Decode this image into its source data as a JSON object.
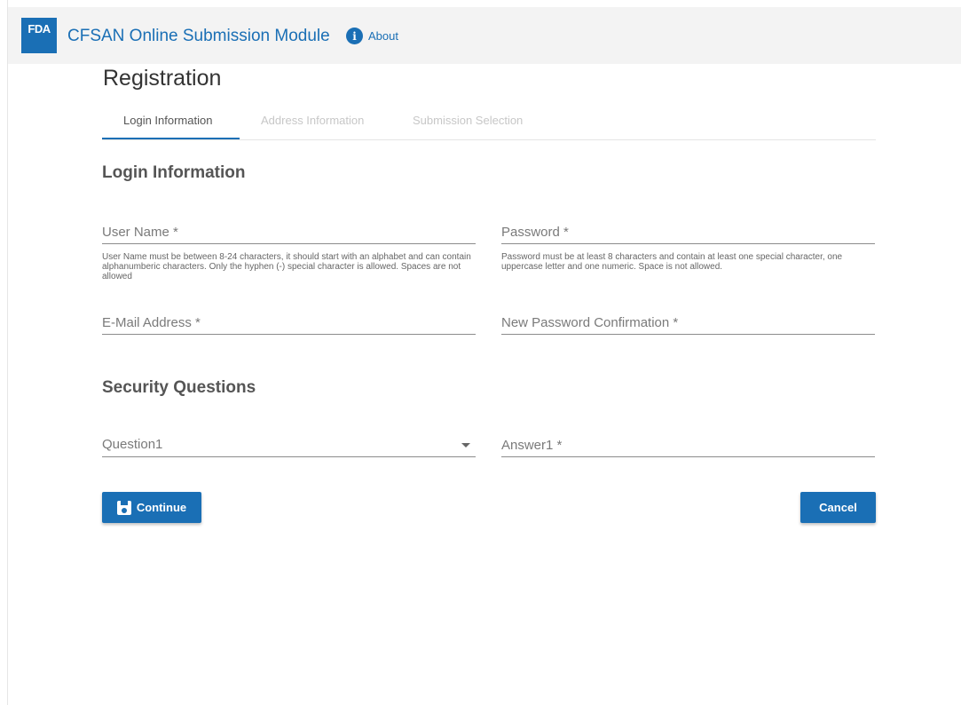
{
  "header": {
    "logo_text": "FDA",
    "title": "CFSAN Online Submission Module",
    "info_icon": "info-icon",
    "info_glyph": "i",
    "about_label": "About"
  },
  "page": {
    "title": "Registration"
  },
  "tabs": [
    {
      "label": "Login Information",
      "active": true
    },
    {
      "label": "Address Information",
      "active": false
    },
    {
      "label": "Submission Selection",
      "active": false
    }
  ],
  "login_section": {
    "title": "Login Information",
    "username": {
      "placeholder": "User Name *",
      "value": "",
      "hint": "User Name must be between 8-24 characters, it should start with an alphabet and can contain alphanumberic characters. Only the hyphen (-) special character is allowed. Spaces are not allowed"
    },
    "password": {
      "placeholder": "Password *",
      "value": "",
      "hint": "Password must be at least 8 characters and contain at least one special character, one uppercase letter and one numeric. Space is not allowed."
    },
    "email": {
      "placeholder": "E-Mail Address *",
      "value": ""
    },
    "password_confirm": {
      "placeholder": "New Password Confirmation *",
      "value": ""
    }
  },
  "security_section": {
    "title": "Security Questions",
    "question": {
      "selected": "Question1",
      "icon": "chevron-down-icon"
    },
    "answer": {
      "placeholder": "Answer1 *",
      "value": ""
    }
  },
  "actions": {
    "continue_label": "Continue",
    "continue_icon": "save-icon",
    "cancel_label": "Cancel"
  },
  "colors": {
    "brand": "#1a6fb5",
    "header_bg": "#f3f3f3",
    "inactive_tab": "#c7c7c7"
  }
}
